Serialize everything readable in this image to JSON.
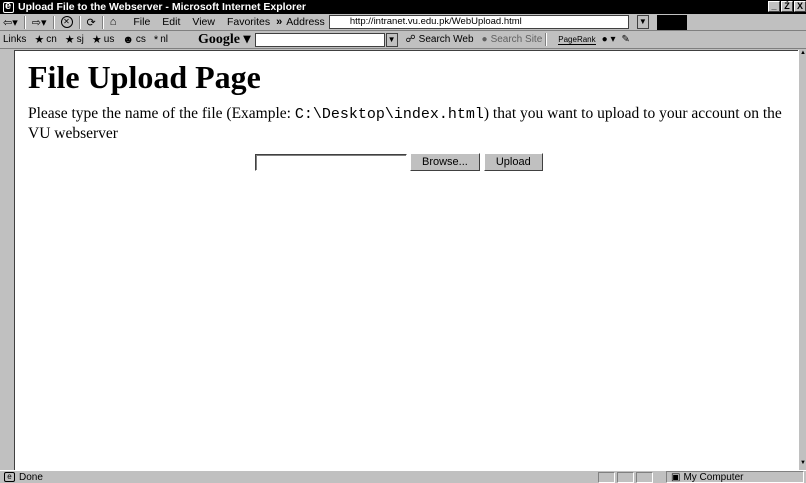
{
  "window": {
    "title": "Upload File to the Webserver - Microsoft Internet Explorer",
    "controls": [
      "_",
      "Ź",
      "X"
    ]
  },
  "toolbar": {
    "back_icon": "back-arrow",
    "forward_icon": "forward-arrow",
    "stop_icon": "stop",
    "refresh_icon": "refresh",
    "home_icon": "home",
    "menu": [
      "File",
      "Edit",
      "View",
      "Favorites"
    ],
    "more": "»",
    "address_label": "Address",
    "address_value": "http://intranet.vu.edu.pk/WebUpload.html"
  },
  "links_bar": {
    "label": "Links",
    "items": [
      {
        "icon": "globe-icon",
        "label": "cn"
      },
      {
        "icon": "globe-icon",
        "label": "sj"
      },
      {
        "icon": "globe-icon",
        "label": "us"
      },
      {
        "icon": "people-icon",
        "label": "cs"
      },
      {
        "icon": "star-icon",
        "label": "nl"
      }
    ],
    "google_label": "Google ▾",
    "search_web": "Search Web",
    "search_site": "Search Site",
    "pagerank": "PageRank"
  },
  "page": {
    "heading": "File Upload Page",
    "text_before": "Please type the name of the file (Example: ",
    "example_path": "C:\\Desktop\\index.html",
    "text_after": ") that you want to upload to your account on the VU webserver",
    "browse_label": "Browse...",
    "upload_label": "Upload",
    "file_value": ""
  },
  "status": {
    "text": "Done",
    "zone": "My Computer"
  },
  "colors": {
    "chrome": "#c0c0c0",
    "titlebar": "#000000",
    "content_bg": "#ffffff"
  }
}
